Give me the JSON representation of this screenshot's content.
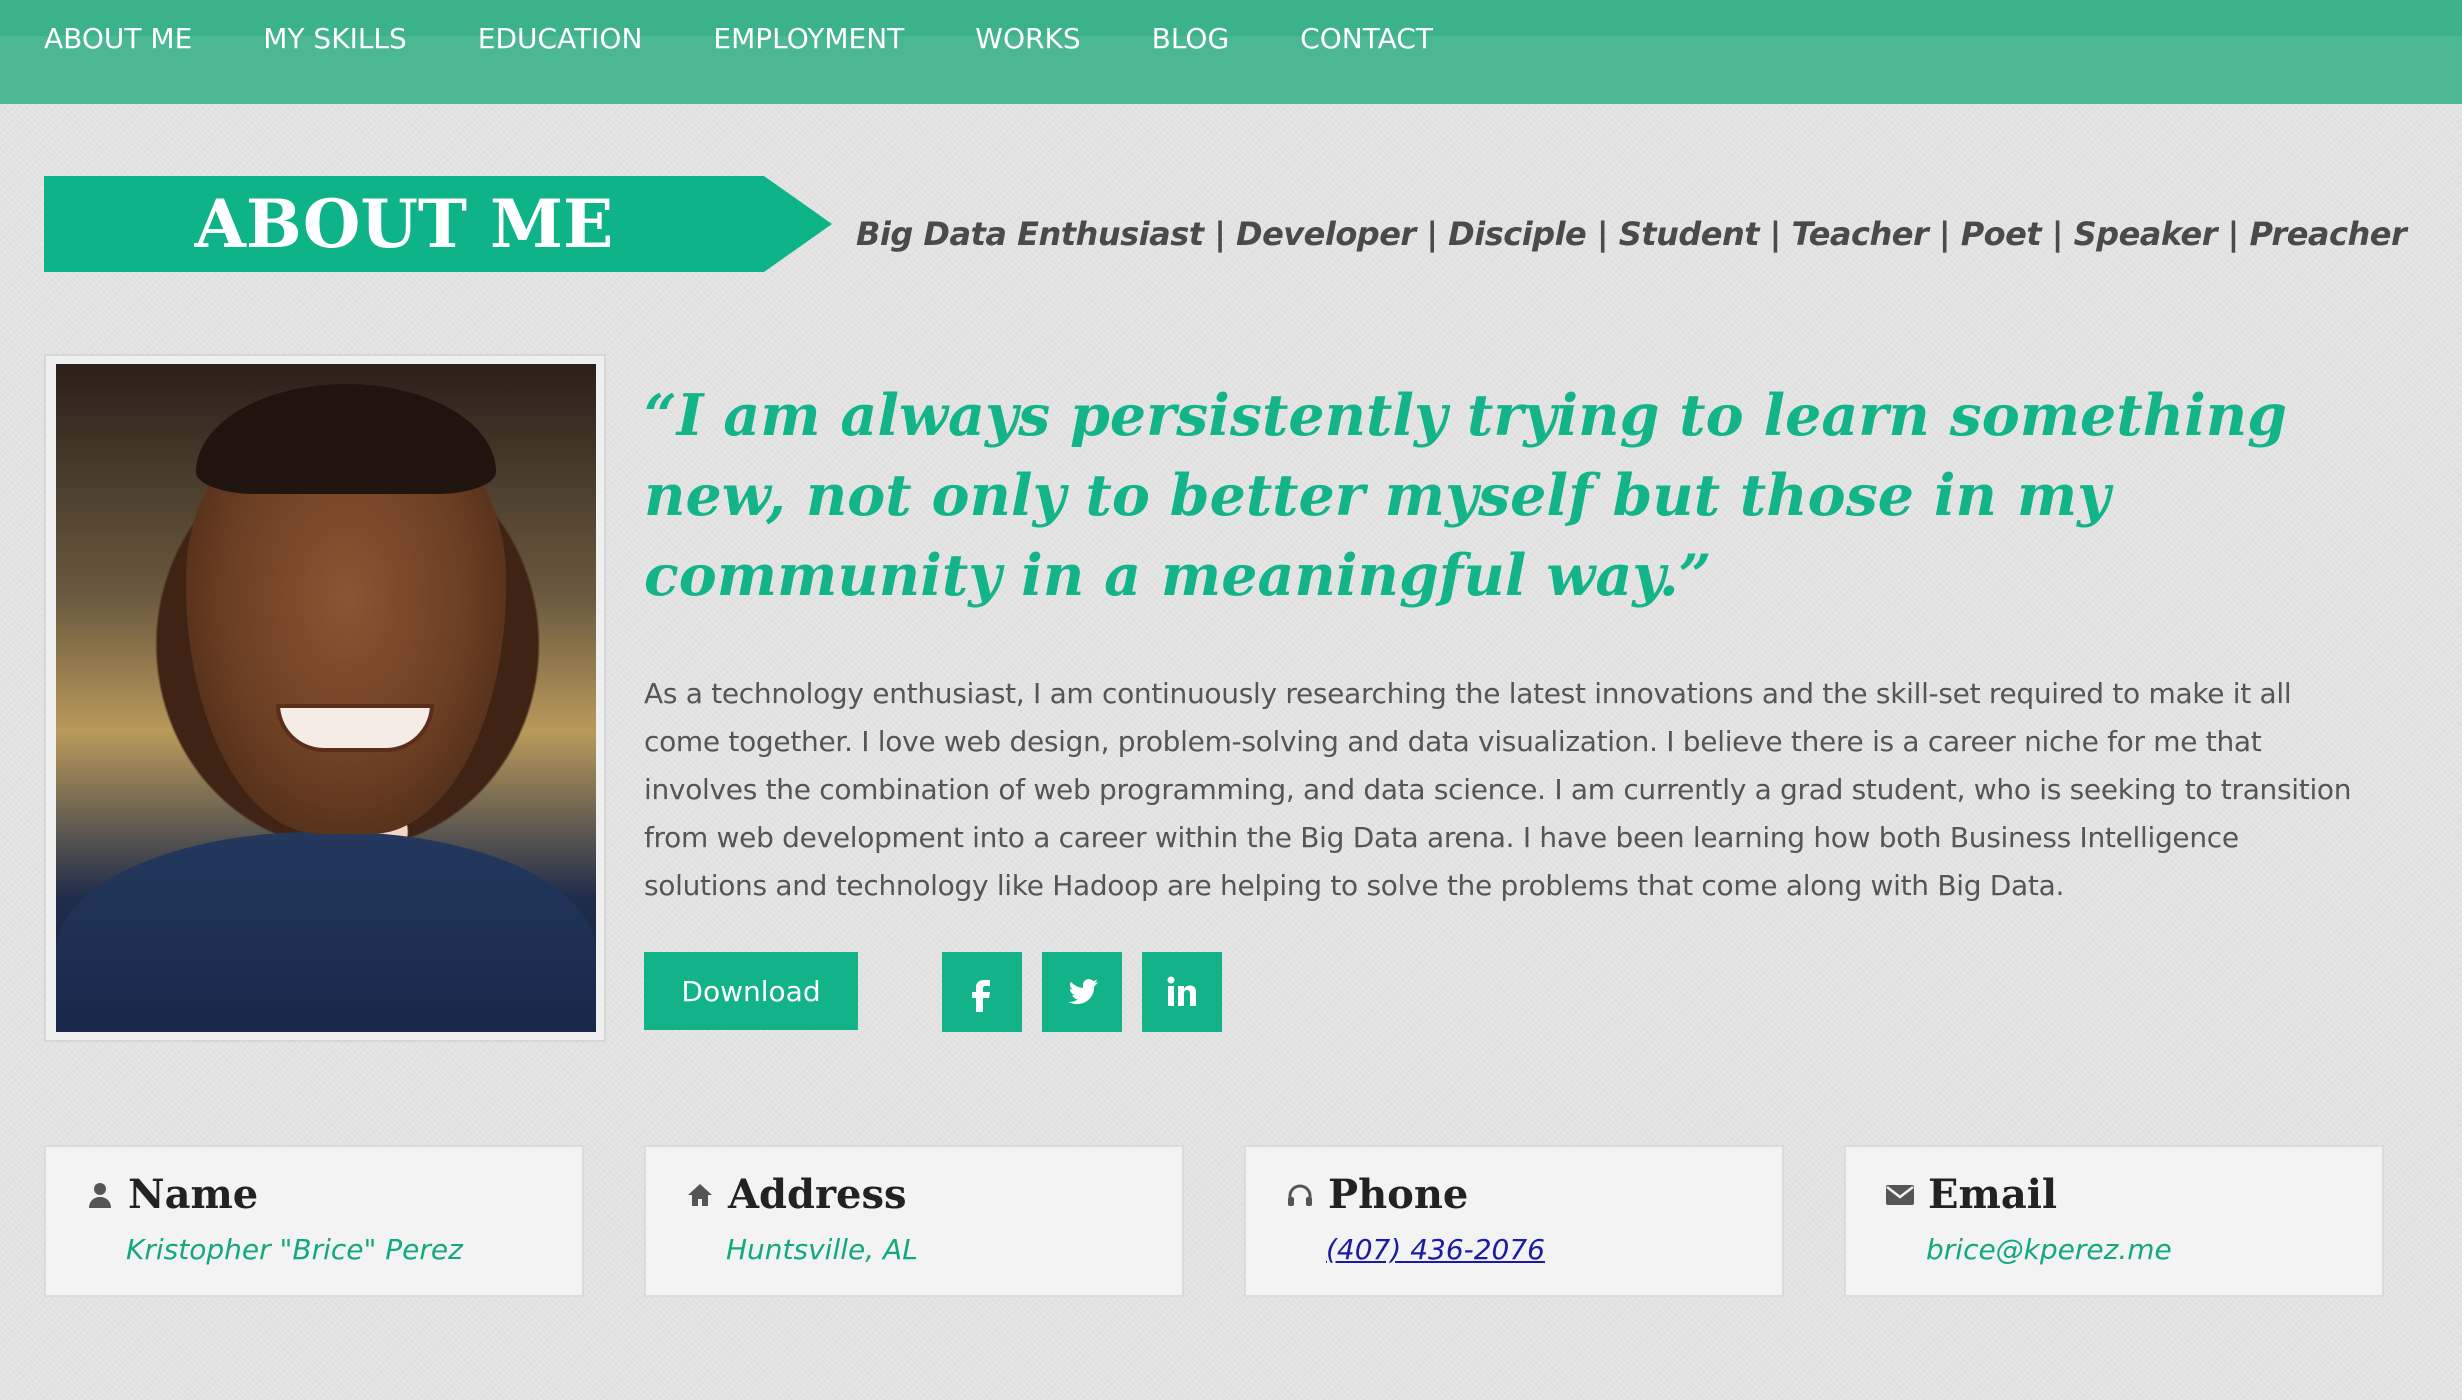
{
  "nav": {
    "items": [
      "ABOUT ME",
      "MY SKILLS",
      "EDUCATION",
      "EMPLOYMENT",
      "WORKS",
      "BLOG",
      "CONTACT"
    ]
  },
  "section": {
    "title": "ABOUT ME",
    "tagline": "Big Data Enthusiast | Developer | Disciple | Student | Teacher | Poet | Speaker | Preacher"
  },
  "about": {
    "quote": "“I am always persistently trying to learn something new, not only to better myself but those in my community in a meaningful way.”",
    "bio": "As a technology enthusiast, I am continuously researching the latest innovations and the skill-set required to make it all come together. I love web design, problem-solving and data visualization. I believe there is a career niche for me that involves the combination of web programming, and data science. I am currently a grad student, who is seeking to transition from web development into a career within the Big Data arena. I have been learning how both Business Intelligence solutions and technology like Hadoop are helping to solve the problems that come along with Big Data.",
    "download_label": "Download",
    "social": [
      {
        "icon": "facebook-icon",
        "glyph": "f"
      },
      {
        "icon": "twitter-icon",
        "glyph": "🐦"
      },
      {
        "icon": "linkedin-icon",
        "glyph": "in"
      }
    ]
  },
  "contact": {
    "name": {
      "label": "Name",
      "value": "Kristopher \"Brice\" Perez",
      "icon": "user-icon"
    },
    "address": {
      "label": "Address",
      "value": "Huntsville, AL",
      "icon": "home-icon"
    },
    "phone": {
      "label": "Phone",
      "value": "(407) 436-2076",
      "icon": "headphones-icon"
    },
    "email": {
      "label": "Email",
      "value": "brice@kperez.me",
      "icon": "envelope-icon"
    }
  },
  "colors": {
    "accent": "#12b388",
    "nav_bg": "#4cb893"
  }
}
